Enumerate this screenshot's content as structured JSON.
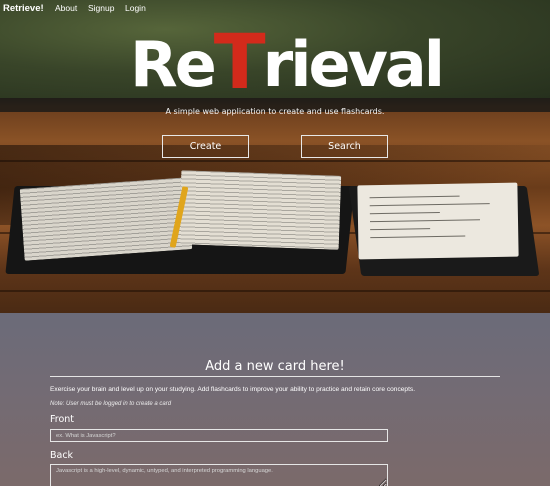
{
  "nav": {
    "brand": "Retrieve!",
    "about": "About",
    "signup": "Signup",
    "login": "Login"
  },
  "hero": {
    "logo_before": "Re",
    "logo_accent": "T",
    "logo_after": "rieval",
    "tagline": "A simple web application to create and use flashcards.",
    "create_label": "Create",
    "search_label": "Search"
  },
  "form": {
    "title": "Add a new card here!",
    "description": "Exercise your brain and level up on your studying. Add flashcards to improve your ability to practice and retain core concepts.",
    "note": "Note: User must be logged in to create a card",
    "front_label": "Front",
    "front_placeholder": "ex. What is Javascript?",
    "back_label": "Back",
    "back_placeholder": "Javascript is a high-level, dynamic, untyped, and interpreted programming language."
  },
  "colors": {
    "accent_red": "#d32a1b",
    "form_bg": "#736b74"
  }
}
